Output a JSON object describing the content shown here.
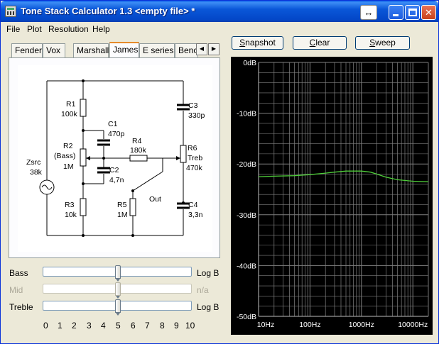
{
  "window": {
    "title": "Tone Stack Calculator 1.3 <empty file> *",
    "extra_button_glyph": "↔",
    "close_glyph": "✕"
  },
  "menu": [
    "File",
    "Plot",
    "Resolution",
    "Help"
  ],
  "tabs": {
    "items": [
      "Fender",
      "Vox",
      "Marshall",
      "James",
      "E series",
      "Benc"
    ],
    "active": "James",
    "scroll_left": "◀",
    "scroll_right": "▶"
  },
  "buttons": {
    "snapshot": {
      "underline": "S",
      "rest": "napshot"
    },
    "clear": {
      "underline": "C",
      "rest": "lear"
    },
    "sweep": {
      "underline": "S",
      "rest": "weep"
    }
  },
  "schematic": {
    "r1": {
      "name": "R1",
      "value": "100k"
    },
    "c1": {
      "name": "C1",
      "value": "470p"
    },
    "c3": {
      "name": "C3",
      "value": "330p"
    },
    "r2": {
      "name": "R2",
      "note": "(Bass)",
      "value": "1M"
    },
    "r4": {
      "name": "R4",
      "value": "180k"
    },
    "r6": {
      "name": "R6",
      "note": "Treb",
      "value": "470k"
    },
    "zsrc": {
      "name": "Zsrc",
      "value": "38k"
    },
    "c2": {
      "name": "C2",
      "value": "4,7n"
    },
    "out": "Out",
    "r3": {
      "name": "R3",
      "value": "10k"
    },
    "r5": {
      "name": "R5",
      "value": "1M"
    },
    "c4": {
      "name": "C4",
      "value": "3,3n"
    }
  },
  "sliders": [
    {
      "label": "Bass",
      "value": 5,
      "taper": "Log B",
      "enabled": true
    },
    {
      "label": "Mid",
      "value": 5,
      "taper": "n/a",
      "enabled": false
    },
    {
      "label": "Treble",
      "value": 5,
      "taper": "Log B",
      "enabled": true
    }
  ],
  "slider_scale": [
    "0",
    "1",
    "2",
    "3",
    "4",
    "5",
    "6",
    "7",
    "8",
    "9",
    "10"
  ],
  "chart_data": {
    "type": "line",
    "title": "",
    "xlabel": "",
    "ylabel": "",
    "x_scale": "log",
    "xlim": [
      10,
      20000
    ],
    "ylim": [
      -50,
      0
    ],
    "x_ticks": [
      "10Hz",
      "100Hz",
      "1000Hz",
      "10000Hz"
    ],
    "y_ticks": [
      "0dB",
      "-10dB",
      "-20dB",
      "-30dB",
      "-40dB",
      "-50dB"
    ],
    "grid": true,
    "background": "#000000",
    "grid_color": "#808080",
    "axis_text_color": "#ffffff",
    "series": [
      {
        "color": "#4fce3a",
        "x": [
          10,
          20,
          50,
          100,
          200,
          300,
          500,
          700,
          1000,
          1500,
          2000,
          3000,
          5000,
          10000,
          20000
        ],
        "values": [
          -22.5,
          -22.4,
          -22.3,
          -22.1,
          -21.8,
          -21.6,
          -21.4,
          -21.4,
          -21.4,
          -21.6,
          -22.0,
          -22.6,
          -23.1,
          -23.4,
          -23.5
        ]
      }
    ]
  }
}
